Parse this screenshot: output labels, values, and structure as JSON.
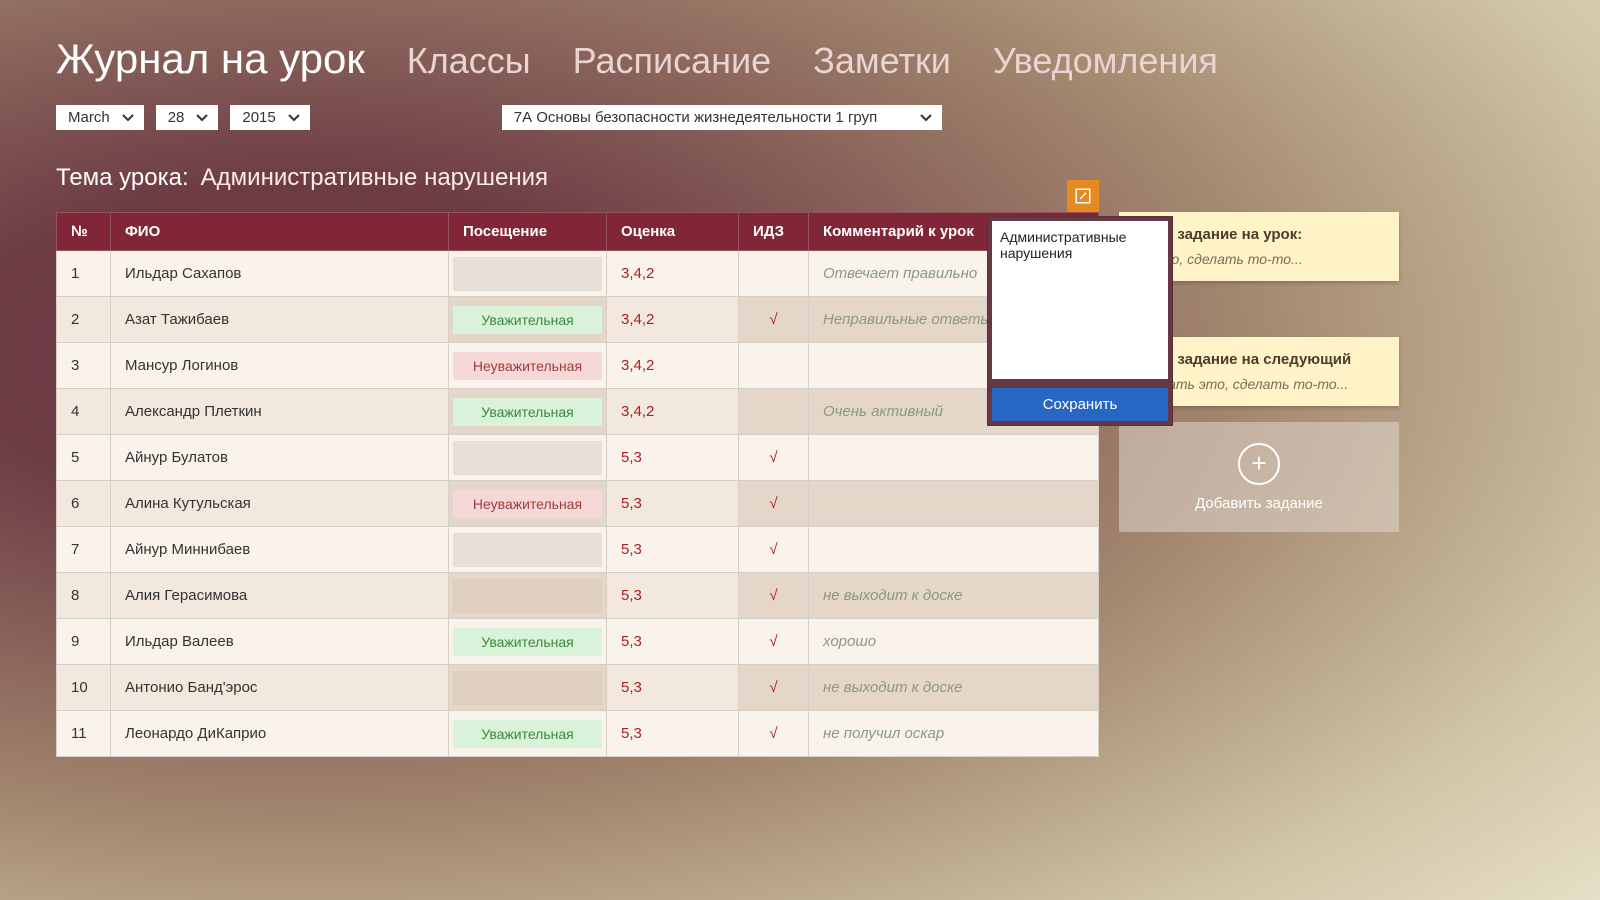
{
  "header": {
    "app_title": "Журнал на урок",
    "nav": [
      "Классы",
      "Расписание",
      "Заметки",
      "Уведомления"
    ]
  },
  "date": {
    "month": "March",
    "day": "28",
    "year": "2015"
  },
  "subject": "7А Основы безопасности жизнедеятельности 1 груп",
  "lesson_topic_label": "Тема урока:",
  "lesson_topic_value": "Административные нарушения",
  "columns": {
    "num": "№",
    "name": "ФИО",
    "attend": "Посещение",
    "grade": "Оценка",
    "idz": "ИДЗ",
    "comment": "Комментарий к урок"
  },
  "rows": [
    {
      "n": "1",
      "name": "Ильдар Сахапов",
      "attend": "",
      "attend_kind": "empty",
      "grade": "3,4,2",
      "idz": "",
      "comment": "Отвечает правильно"
    },
    {
      "n": "2",
      "name": "Азат Тажибаев",
      "attend": "Уважительная",
      "attend_kind": "green",
      "grade": "3,4,2",
      "idz": "√",
      "comment": "Неправильные ответы"
    },
    {
      "n": "3",
      "name": "Мансур Логинов",
      "attend": "Неуважительная",
      "attend_kind": "red",
      "grade": "3,4,2",
      "idz": "",
      "comment": ""
    },
    {
      "n": "4",
      "name": "Александр Плеткин",
      "attend": "Уважительная",
      "attend_kind": "green",
      "grade": "3,4,2",
      "idz": "",
      "comment": "Очень активный"
    },
    {
      "n": "5",
      "name": "Айнур Булатов",
      "attend": "",
      "attend_kind": "empty",
      "grade": "5,3",
      "idz": "√",
      "comment": ""
    },
    {
      "n": "6",
      "name": "Алина Кутульская",
      "attend": "Неуважительная",
      "attend_kind": "red",
      "grade": "5,3",
      "idz": "√",
      "comment": ""
    },
    {
      "n": "7",
      "name": "Айнур Миннибаев",
      "attend": "",
      "attend_kind": "empty",
      "grade": "5,3",
      "idz": "√",
      "comment": ""
    },
    {
      "n": "8",
      "name": "Алия Герасимова",
      "attend": "",
      "attend_kind": "empty",
      "grade": "5,3",
      "idz": "√",
      "comment": "не выходит к доске"
    },
    {
      "n": "9",
      "name": "Ильдар Валеев",
      "attend": "Уважительная",
      "attend_kind": "green",
      "grade": "5,3",
      "idz": "√",
      "comment": "хорошо"
    },
    {
      "n": "10",
      "name": "Антонио Банд'эрос",
      "attend": "",
      "attend_kind": "empty",
      "grade": "5,3",
      "idz": "√",
      "comment": "не выходит к доске"
    },
    {
      "n": "11",
      "name": "Леонардо ДиКаприо",
      "attend": "Уважительная",
      "attend_kind": "green",
      "grade": "5,3",
      "idz": "√",
      "comment": "не получил оскар"
    }
  ],
  "popup": {
    "text": "Административные нарушения",
    "save_label": "Сохранить"
  },
  "hw_current": {
    "title": "шнее задание на урок:",
    "body": "гь это, сделать то-то..."
  },
  "hw_next": {
    "title": "шнее задание на следующий",
    "body": "Сделать это, сделать то-то..."
  },
  "add_task_label": "Добавить задание"
}
